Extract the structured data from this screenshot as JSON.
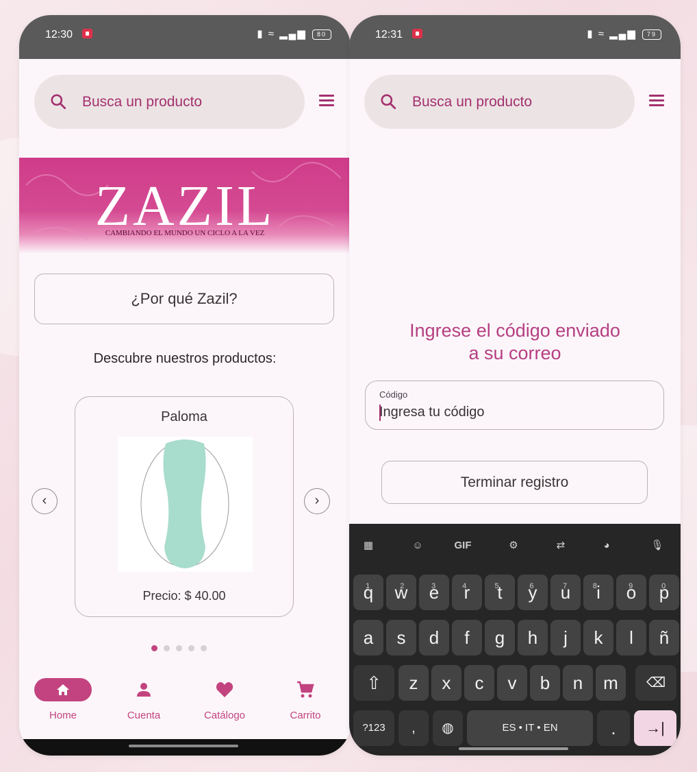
{
  "left_screen": {
    "status": {
      "time": "12:30",
      "battery": "80"
    },
    "search": {
      "placeholder": "Busca un producto"
    },
    "banner": {
      "logo": "ZAZIL",
      "tagline": "CAMBIANDO EL MUNDO UN CICLO A LA VEZ"
    },
    "why_button": "¿Por qué Zazil?",
    "discover_heading": "Descubre nuestros productos:",
    "product": {
      "name": "Paloma",
      "price": "Precio: $ 40.00"
    },
    "carousel": {
      "count": 5,
      "active_index": 0
    },
    "nav": [
      {
        "label": "Home",
        "icon": "home-icon",
        "active": true
      },
      {
        "label": "Cuenta",
        "icon": "person-icon",
        "active": false
      },
      {
        "label": "Catálogo",
        "icon": "heart-icon",
        "active": false
      },
      {
        "label": "Carrito",
        "icon": "cart-icon",
        "active": false
      }
    ]
  },
  "right_screen": {
    "status": {
      "time": "12:31",
      "battery": "79"
    },
    "search": {
      "placeholder": "Busca un producto"
    },
    "title_line1": "Ingrese el código enviado",
    "title_line2": "a su correo",
    "code_field": {
      "label": "Código",
      "placeholder": "Ingresa tu código"
    },
    "finish_button": "Terminar registro",
    "keyboard": {
      "row1": [
        "q",
        "w",
        "e",
        "r",
        "t",
        "y",
        "u",
        "i",
        "o",
        "p"
      ],
      "row1_hints": [
        "1",
        "2",
        "3",
        "4",
        "5",
        "6",
        "7",
        "8",
        "9",
        "0"
      ],
      "row2": [
        "a",
        "s",
        "d",
        "f",
        "g",
        "h",
        "j",
        "k",
        "l",
        "ñ"
      ],
      "row3": [
        "z",
        "x",
        "c",
        "v",
        "b",
        "n",
        "m"
      ],
      "symbols_key": "?123",
      "comma_key": ",",
      "space_label": "ES • IT • EN",
      "period_key": ".",
      "gif_label": "GIF"
    }
  },
  "colors": {
    "accent": "#c2437f",
    "accent_text": "#a4306f",
    "banner": "#d44a92",
    "search_bg": "#ece4e4"
  }
}
